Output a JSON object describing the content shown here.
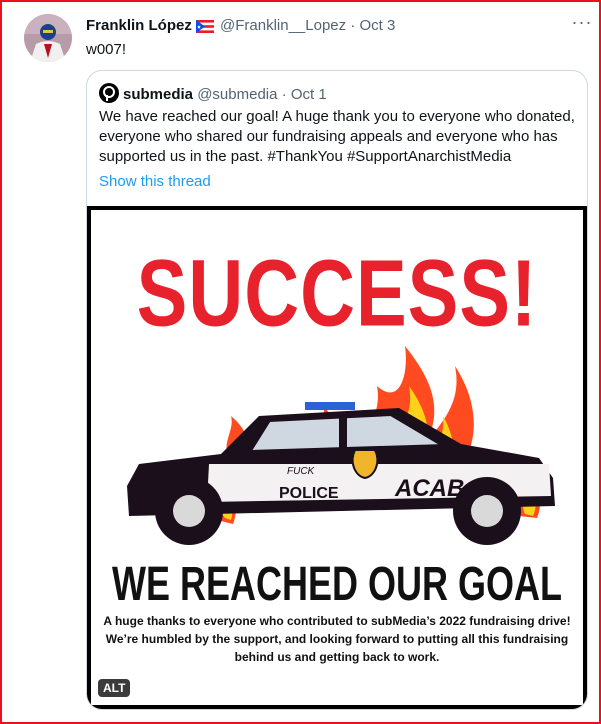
{
  "tweet": {
    "author_name": "Franklin López",
    "handle": "@Franklin__Lopez",
    "separator": "·",
    "date": "Oct 3",
    "text": "w007!",
    "more_label": "···"
  },
  "quoted_tweet": {
    "author_name": "submedia",
    "handle": "@submedia",
    "separator": "·",
    "date": "Oct 1",
    "text_lines": [
      "We have reached our goal! A huge thank you to everyone who donated,",
      "everyone who shared our fundraising appeals and everyone who has",
      "supported us in the past. #ThankYou #SupportAnarchistMedia"
    ],
    "show_thread_label": "Show this thread"
  },
  "media": {
    "headline": "SUCCESS!",
    "goal_text": "WE REACHED OUR GOAL",
    "sub_lines": [
      "A huge thanks to everyone who contributed to subMedia’s 2022 fundraising drive!",
      "We’re humbled by the support, and looking forward to putting all this fundraising",
      "behind us and getting back to work."
    ],
    "car_door_text": "POLICE",
    "car_graffiti_1": "ACAB",
    "car_graffiti_2": "FUCK",
    "alt_badge": "ALT"
  },
  "colors": {
    "frame_border": "#e8111c",
    "link_blue": "#1d9bf0",
    "muted_text": "#536471",
    "headline_red": "#e8222d"
  }
}
